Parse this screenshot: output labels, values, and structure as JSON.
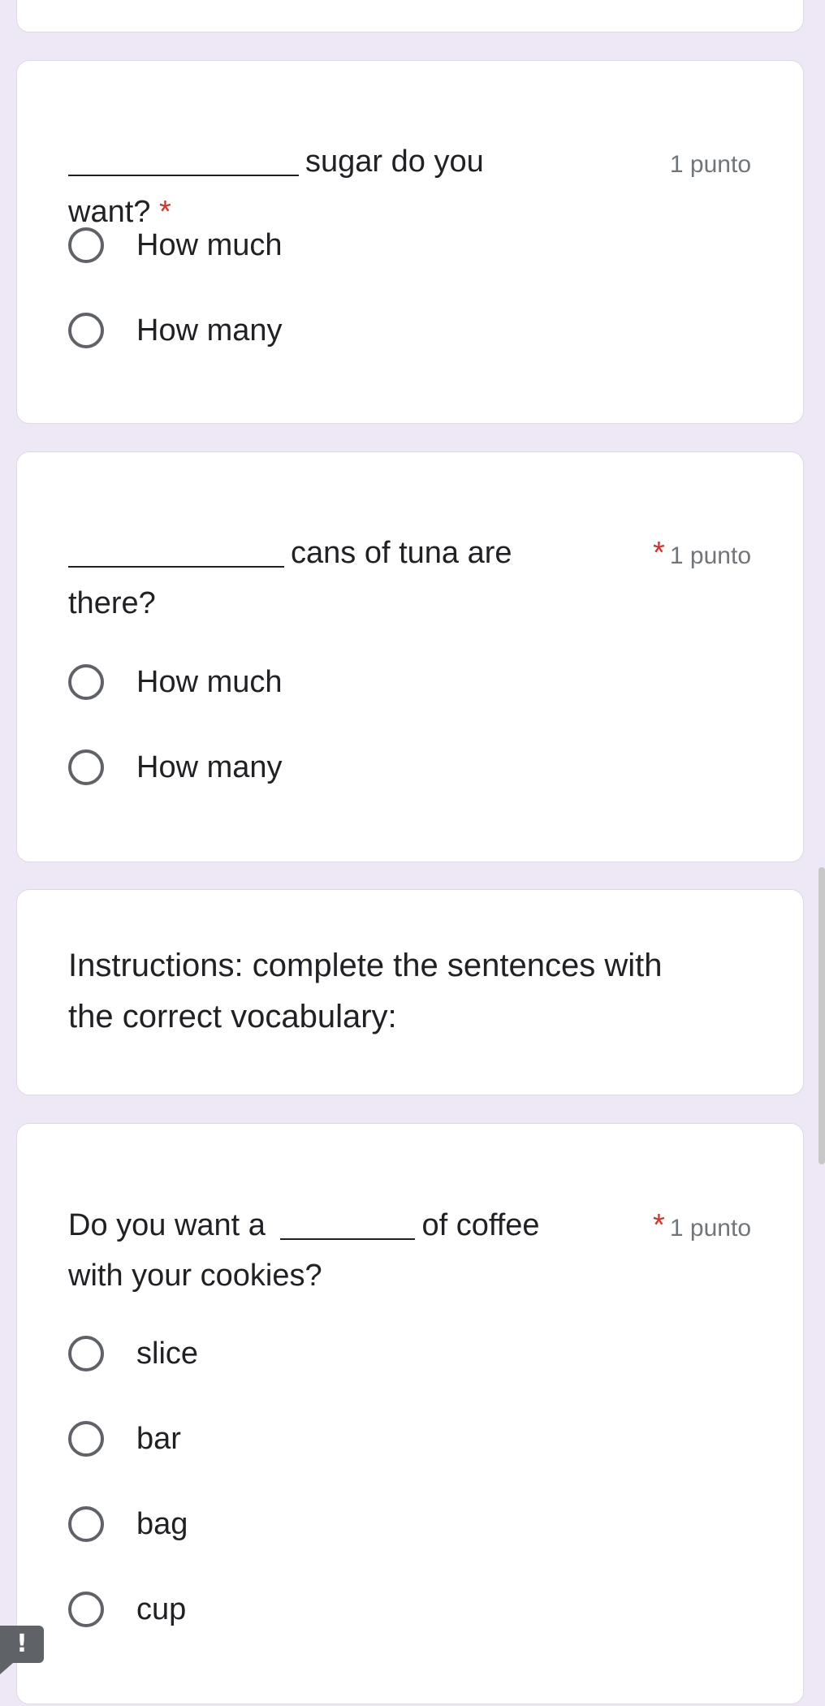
{
  "q_sugar": {
    "title": "sugar do you want?",
    "required": "*",
    "points": "1 punto",
    "options": [
      "How much",
      "How many"
    ]
  },
  "q_tuna": {
    "title_line1": "cans of tuna are",
    "title_line2": "there?",
    "required": "*",
    "points": "1 punto",
    "options": [
      "How much",
      "How many"
    ]
  },
  "instructions": {
    "line1": "Instructions: complete the sentences with",
    "line2": "the correct vocabulary:"
  },
  "q_coffee": {
    "title_before": "Do you want a",
    "title_after": "of coffee",
    "title_line2": "with your cookies?",
    "required": "*",
    "points": "1 punto",
    "options": [
      "slice",
      "bar",
      "bag",
      "cup"
    ]
  },
  "report_button": {
    "label": "!"
  },
  "colors": {
    "background": "#ede7f6",
    "required": "#d93025",
    "radio": "#5f6368"
  }
}
